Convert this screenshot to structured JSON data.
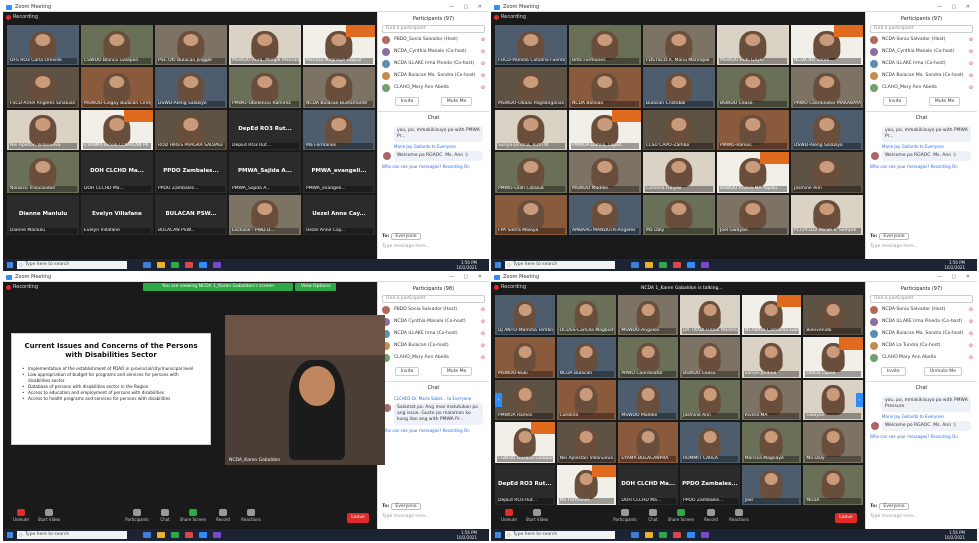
{
  "window_title": "Zoom Meeting",
  "recording_label": "Recording",
  "taskbar": {
    "search_placeholder": "Type here to search",
    "time": "1:56 PM",
    "date": "10/2/2021"
  },
  "window_buttons": "— ▢ ✕",
  "q0": {
    "tiles": [
      {
        "name": "DFS RO3 Carla Orevillo"
      },
      {
        "name": "CSWDO Blanca Galapon"
      },
      {
        "name": "PSC Ofc Bulacan Jinggle"
      },
      {
        "name": "MSWDO-Aura, Margie Mansanares"
      },
      {
        "name": "Marissa Magnaye-Gapuz"
      },
      {
        "name": "FSCD-Arnel Angeles Sinaluan"
      },
      {
        "name": "MSWDO-Lingoy Bulacan Cindy"
      },
      {
        "name": "DSWD-Aleng Salaziyo"
      },
      {
        "name": "PMWO-Obidencio Ramirez"
      },
      {
        "name": "NCDA Bulacan Bustamante"
      },
      {
        "name": "Nei Apiston Villanueva"
      },
      {
        "name": "EYANMA Bicolo COMPLAN PR"
      },
      {
        "name": "ROD HIRES PRAGRA SALVAGI"
      },
      {
        "name": "DepEd RO3 Rut..."
      },
      {
        "name": "Ma Formanes"
      },
      {
        "name": "Nolasco Trancandon"
      },
      {
        "name": "DOH CLCHD Ma..."
      },
      {
        "name": "PPDO Zambales..."
      },
      {
        "name": "PMWA_Sajida A..."
      },
      {
        "name": "PMWA_evangeli..."
      },
      {
        "name": "Dianne Manlulu"
      },
      {
        "name": "Evelyn Villafane"
      },
      {
        "name": "BULACAN PSW..."
      },
      {
        "name": "Exclusie - PWD D..."
      },
      {
        "name": "Uezel Anne Cay..."
      }
    ],
    "bignames": [
      "DepEd RO3 Rut...",
      "DOH CLCHD Ma...",
      "PPDO Zambales...",
      "PMWA_Sajida A...",
      "PMWA_evangeli...",
      "Dianne Manlulu",
      "Evelyn Villafane",
      "BULACAN PSW...",
      "Uezel Anne Cay..."
    ],
    "participants_title": "Participants (97)",
    "search_placeholder": "Find a participant",
    "participants": [
      "PBDD_Sonia Salvador (Host)",
      "NCDA_Cynthia Manalo (Co-host)",
      "NCDA ILLAKE Irma Pineda (Co-host)",
      "NCDA Bulacan Ma. Sandra (Co-host)",
      "CLAHO_Mary Ann Abella"
    ],
    "invite": "Invite",
    "mute_all": "Mute Me",
    "chat_title": "Chat",
    "chat_messages": [
      {
        "from": "",
        "text": "you, po, mmakikisuyo po with PMWA Pr..."
      },
      {
        "from": "Marie Joy Gallardo to Everyone",
        "text": "Welcome po RGAOC. Ms. Ann :)"
      }
    ],
    "notice": "Who can see your messages? Recording On",
    "to_label": "To:",
    "to_value": "Everyone",
    "type_message": "Type message here..."
  },
  "q1": {
    "tiles": [
      {
        "name": "FOCD-Pamela Catalina Fuentes"
      },
      {
        "name": "Bifia Formanes"
      },
      {
        "name": "FDSTSCO R. Mario Manrique"
      },
      {
        "name": "MSWDO-Buki Gayle"
      },
      {
        "name": "NCDA RO Sonia"
      },
      {
        "name": "MSWDO-Obaas Pagdanganan"
      },
      {
        "name": "NCDA Bolinao"
      },
      {
        "name": "Bulacan Cristobal"
      },
      {
        "name": "BSWDO Ceaso"
      },
      {
        "name": "PRWO Coordinator MAKABAYAN"
      },
      {
        "name": "Sariya-Jordina, Ruth M."
      },
      {
        "name": "PMWOA Dahlia, Lopez"
      },
      {
        "name": "CLSU CAPO-Zambo"
      },
      {
        "name": "PMWO-Ramos"
      },
      {
        "name": "DSWD-Aleng Salaziyo"
      },
      {
        "name": "PMWO-Lilah Catalua"
      },
      {
        "name": "MSWDO Maddie"
      },
      {
        "name": "Carolina Isaiyas"
      },
      {
        "name": "BSWDO Rivera MA Aquilu"
      },
      {
        "name": "Jasmine Ann"
      },
      {
        "name": "FPA Sierra Malaya"
      },
      {
        "name": "AMBAAG MANDOTA-Angeles"
      },
      {
        "name": "Ma Daly"
      },
      {
        "name": "Joel Gwayan"
      },
      {
        "name": "PCCPI-LD2 Micah V. Sempre"
      }
    ],
    "participants_title": "Participants (97)",
    "search_placeholder": "Find a participant",
    "participants": [
      "NCDA-Sonia Salvador (Host)",
      "NCDA_Cynthia Manalo (Co-host)",
      "NCDA ILLAKE Irma (Co-host)",
      "NCDA Bulacan Ma. Sandra (Co-host)",
      "CLAHO_Mary Ann Abella"
    ],
    "invite": "Invite",
    "mute_all": "Mute Me",
    "chat_title": "Chat",
    "chat_messages": [
      {
        "from": "",
        "text": "you, po, mmakikisuyo po with PMWA Pr..."
      },
      {
        "from": "Marie Joy Gallardo to Everyone",
        "text": "Welcome po RGAOC. Ms. Ann :)"
      }
    ],
    "notice": "Who can see your messages? Recording On",
    "to_label": "To:",
    "to_value": "Everyone",
    "type_message": "Type message here..."
  },
  "q2": {
    "viewing_banner": "You are viewing NCDA 1_Karen Gabaldon's screen",
    "view_options": "View Options",
    "slide_title": "Current Issues and Concerns of the Persons with Disabilities Sector",
    "slide_bullets": [
      "Implementation of the establishment of PDAO in provincial/city/municipal level",
      "Low appropriation of budget for programs and services for persons with disabilities sector",
      "Database of persons with disabilities sector in the Region",
      "Access to education and employment of persons with disabilities",
      "Access to health programs and services for persons with disabilities"
    ],
    "speaker_name": "NCDA_Karen Gabaldon",
    "participants_title": "Participants (98)",
    "search_placeholder": "Find a participant",
    "participants": [
      "PBDD Sonia Salvador (Host)",
      "NCDA Cynthia Manalo (Co-host)",
      "NCDA ILLAKE Irma (Co-host)",
      "NCDA Bulacan (Co-host)",
      "CLAHO_Mary Ann Abella"
    ],
    "invite": "Invite",
    "mute_all": "Mute Me",
    "chat_title": "Chat",
    "chat_messages": [
      {
        "from": "CLCHD3 Dr. Maria Sabel... to Everyone",
        "text": "Salamat po. Ang mas matutukan po ang issue. Gusto po malaman ko kung ilan ang with PMWA Pr..."
      }
    ],
    "notice": "Who can see your messages? Recording On",
    "to_label": "To:",
    "to_value": "Everyone",
    "type_message": "Type message here...",
    "toolbar": [
      "Unmute",
      "Start Video",
      "Participants",
      "Chat",
      "Share Screen",
      "Record",
      "Reactions"
    ],
    "leave": "Leave"
  },
  "q3": {
    "screen_share_label": "NCDA 1_Karen Gabaldon is talking...",
    "tiles": [
      {
        "name": "DJ ANTO-Mamma Tembrito"
      },
      {
        "name": "OCDSS-Camilla Magbiot"
      },
      {
        "name": "MSWDO-Angeles"
      },
      {
        "name": "DA TRADI-Isabel Maramara"
      },
      {
        "name": "MCAWhiz Camacho-Gadlita"
      },
      {
        "name": "Bienvenido"
      },
      {
        "name": "MSWDO-Buki"
      },
      {
        "name": "NCDA Bulacan"
      },
      {
        "name": "PRWO Coordinator"
      },
      {
        "name": "BSWDO Ceaso"
      },
      {
        "name": "Sariya-Jordina"
      },
      {
        "name": "Dahlia Lopez"
      },
      {
        "name": "PMWOA Ramos"
      },
      {
        "name": "Carolina"
      },
      {
        "name": "MSWDO Maddie"
      },
      {
        "name": "Jasmine Ann"
      },
      {
        "name": "Rivera MA"
      },
      {
        "name": "Gwayan"
      },
      {
        "name": "CSWDO Gusana Galapon"
      },
      {
        "name": "Nei Aplestan Villanueva"
      },
      {
        "name": "EYAMA BULACANPRA"
      },
      {
        "name": "ROMMIT CARLA"
      },
      {
        "name": "Marissa Magnaye"
      },
      {
        "name": "Ma Daly"
      },
      {
        "name": "DepEd RO3 Rut..."
      },
      {
        "name": "Ma Formanes"
      },
      {
        "name": "DOH CLCHD Ma..."
      },
      {
        "name": "PPDO Zambales..."
      },
      {
        "name": "Joel"
      },
      {
        "name": "Micah"
      }
    ],
    "participants_title": "Participants (97)",
    "search_placeholder": "Find a participant",
    "participants": [
      "NCDA-Sonia Salvador (Host)",
      "NCDA ILLAKE Irma Pineda (Co-host)",
      "NCDA Bulacan Ma. Sandra (Co-host)",
      "NCDA La Tundro (Co-host)",
      "CLAHO Mary Ann Abella"
    ],
    "invite": "Invite",
    "mute_all": "Unmute Me",
    "chat_title": "Chat",
    "chat_messages": [
      {
        "from": "",
        "text": "you, po, mmakikisuyo po with PMWA Pressure"
      },
      {
        "from": "Marie Joy Gallardo to Everyone",
        "text": "Welcome po RGAOC. Ms. Ann :)"
      }
    ],
    "notice": "Who can see your messages? Recording On",
    "to_label": "To:",
    "to_value": "Everyone",
    "type_message": "Type message here...",
    "toolbar": [
      "Unmute",
      "Start Video",
      "Participants",
      "Chat",
      "Share Screen",
      "Record",
      "Reactions"
    ],
    "leave": "Leave"
  }
}
